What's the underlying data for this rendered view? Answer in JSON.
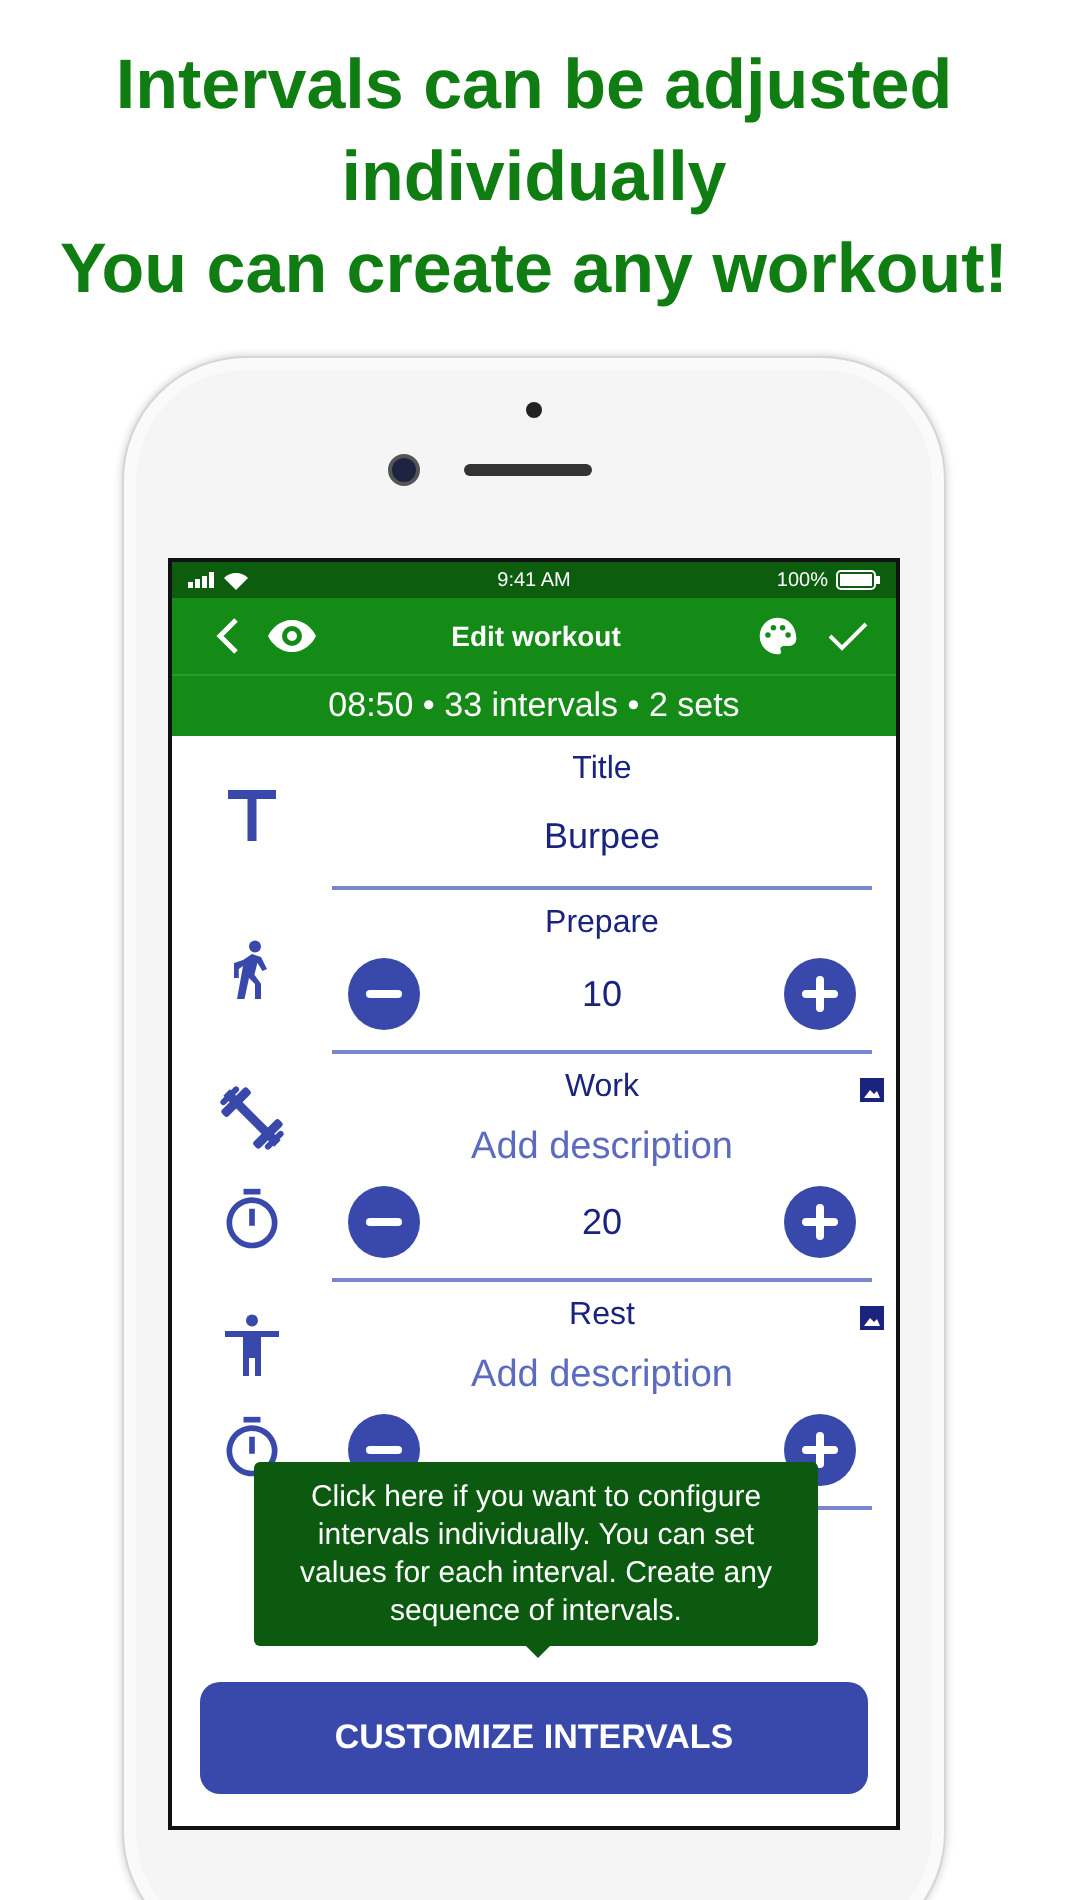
{
  "headline": [
    "Intervals can be adjusted individually",
    "You can create any workout!"
  ],
  "status_bar": {
    "time": "9:41 AM",
    "battery": "100%"
  },
  "nav": {
    "title": "Edit workout"
  },
  "summary": "08:50 • 33 intervals • 2 sets",
  "sections": [
    {
      "kind": "title",
      "label": "Title",
      "value": "Burpee"
    },
    {
      "kind": "prepare",
      "label": "Prepare",
      "value": "10"
    },
    {
      "kind": "work",
      "label": "Work",
      "placeholder": "Add description",
      "value": "20"
    },
    {
      "kind": "rest",
      "label": "Rest",
      "placeholder": "Add description"
    }
  ],
  "tooltip": "Click here if you want to configure intervals individually. You can set values for each interval. Create any sequence of intervals.",
  "button": "CUSTOMIZE INTERVALS"
}
